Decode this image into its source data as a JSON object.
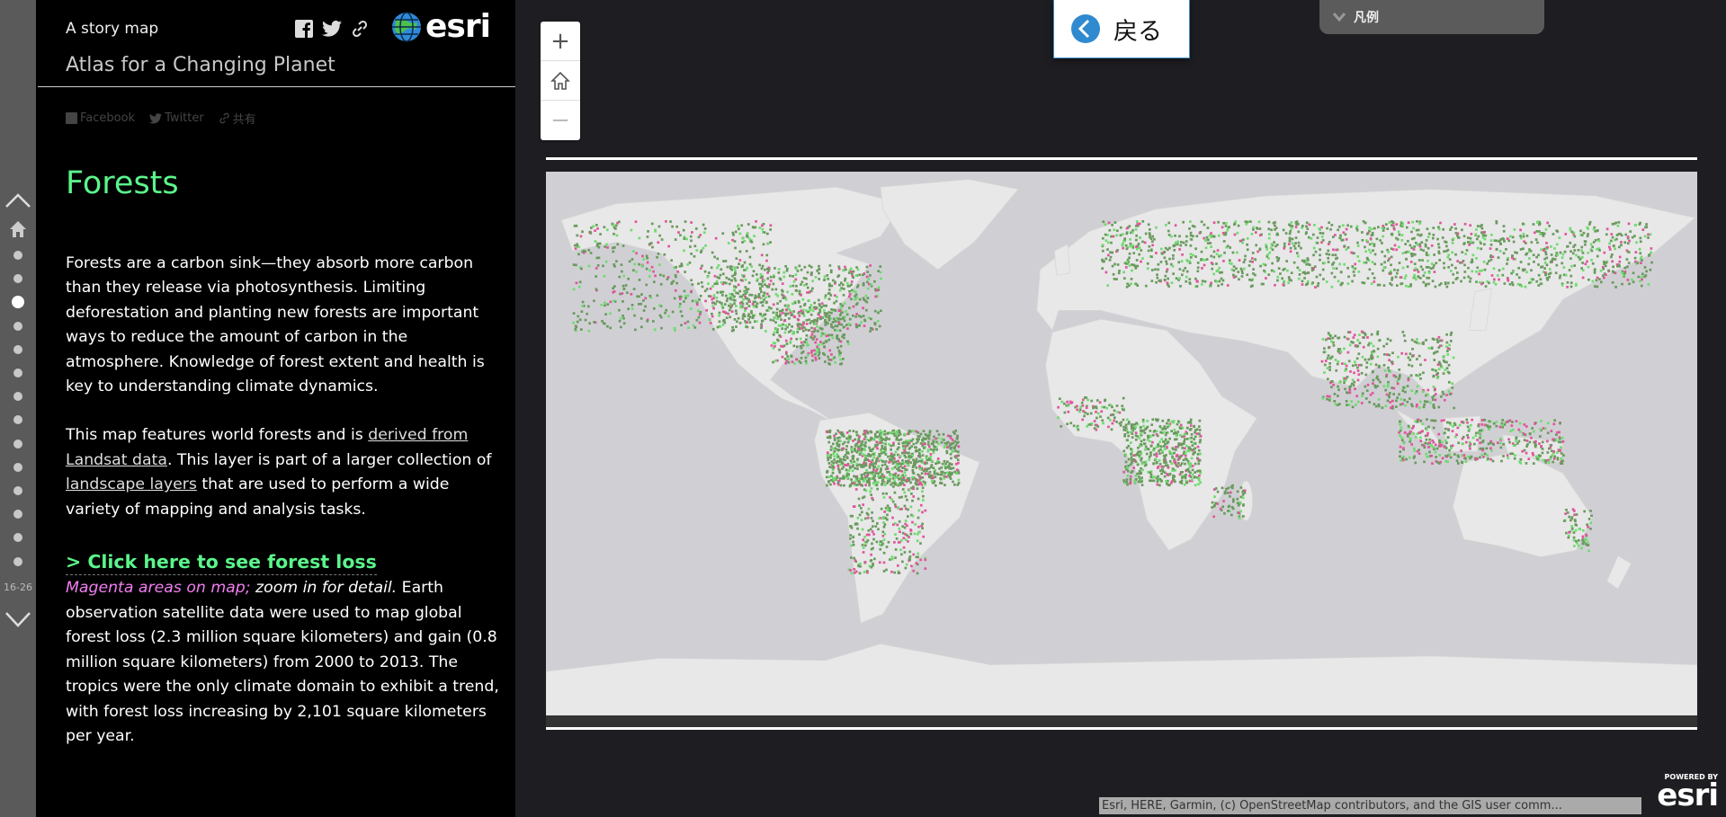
{
  "nav": {
    "count_label": "16-26",
    "dots": 14,
    "active_index": 2
  },
  "header": {
    "subtitle": "A story map",
    "title": "Atlas for a Changing Planet",
    "logo_text": "esri"
  },
  "share": {
    "facebook": "Facebook",
    "twitter": "Twitter",
    "share": "共有"
  },
  "section": {
    "title": "Forests",
    "paragraph1": "Forests are a carbon sink—they absorb more carbon than they release via photosynthesis. Limiting deforestation and planting new forests are important ways to reduce the amount of carbon in the atmosphere. Knowledge of forest extent and health is key to understanding climate dynamics.",
    "p2_a": "This map features world forests and is ",
    "p2_link1": "derived from Landsat data",
    "p2_b": ". This layer is part of a larger collection of ",
    "p2_link2": "landscape layers",
    "p2_c": " that are used to perform a wide variety of mapping and analysis tasks.",
    "cta": "> Click here to see forest loss",
    "p3_magenta": "Magenta areas on map;",
    "p3_italic": " zoom in for detail.",
    "p3_rest": " Earth observation satellite data were used to map global forest loss (2.3 million square kilometers) and gain (0.8 million square kilometers) from 2000 to 2013. The tropics were the only climate domain to exhibit a trend, with forest loss increasing by 2,101 square kilometers per year."
  },
  "map_controls": {
    "zoom_in": "+",
    "home": "home-icon",
    "zoom_out": "−"
  },
  "back_button": {
    "label": "戻る"
  },
  "legend": {
    "label": "凡例"
  },
  "attribution": "Esri, HERE, Garmin, (c) OpenStreetMap contributors, and the GIS user comm...",
  "powered_by": {
    "top": "POWERED BY",
    "logo": "esri"
  },
  "colors": {
    "forest": "#6a9a5e",
    "gain": "#6fdc6f",
    "loss": "#e0569a",
    "land": "#e8e8e8",
    "ocean": "#d0d0d4",
    "accent": "#5bf58b"
  }
}
